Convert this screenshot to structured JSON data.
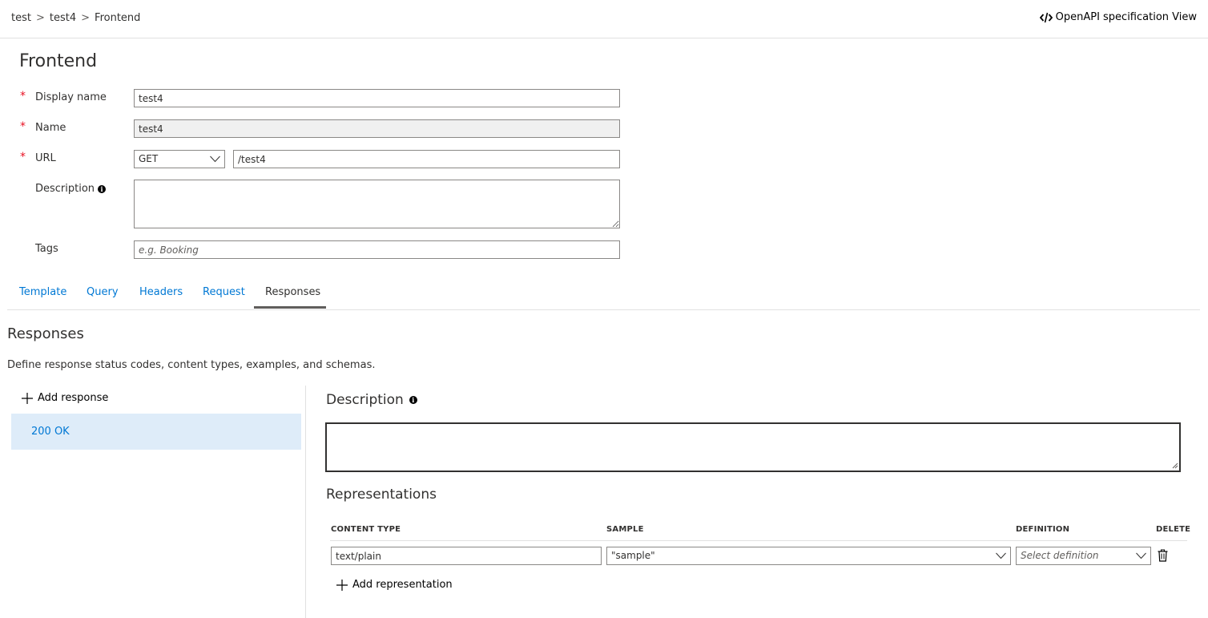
{
  "breadcrumb": {
    "items": [
      "test",
      "test4",
      "Frontend"
    ],
    "separator": ">"
  },
  "header": {
    "openapi_icon": "code-icon",
    "openapi_label": "OpenAPI specification View"
  },
  "page": {
    "title": "Frontend"
  },
  "form": {
    "required_marker": "*",
    "display_name": {
      "label": "Display name",
      "value": "test4"
    },
    "name": {
      "label": "Name",
      "value": "test4"
    },
    "url": {
      "label": "URL",
      "method": "GET",
      "path": "/test4"
    },
    "description": {
      "label": "Description",
      "value": "",
      "info_icon": "info-icon"
    },
    "tags": {
      "label": "Tags",
      "placeholder": "e.g. Booking",
      "value": ""
    }
  },
  "tabs": [
    {
      "label": "Template",
      "active": false
    },
    {
      "label": "Query",
      "active": false
    },
    {
      "label": "Headers",
      "active": false
    },
    {
      "label": "Request",
      "active": false
    },
    {
      "label": "Responses",
      "active": true
    }
  ],
  "responses": {
    "title": "Responses",
    "description": "Define response status codes, content types, examples, and schemas.",
    "add_response_label": "Add response",
    "items": [
      {
        "label": "200 OK",
        "selected": true
      }
    ],
    "detail": {
      "description_title": "Description",
      "description_value": "",
      "representations_title": "Representations",
      "columns": [
        "CONTENT TYPE",
        "SAMPLE",
        "DEFINITION",
        "DELETE"
      ],
      "rows": [
        {
          "content_type": "text/plain",
          "sample": "\"sample\"",
          "definition_placeholder": "Select definition",
          "delete_icon": "trash-icon"
        }
      ],
      "add_representation_label": "Add representation"
    }
  },
  "colors": {
    "accent": "#0078d4",
    "required": "#e81123",
    "selected_bg": "#deecf9",
    "text": "#323130"
  }
}
